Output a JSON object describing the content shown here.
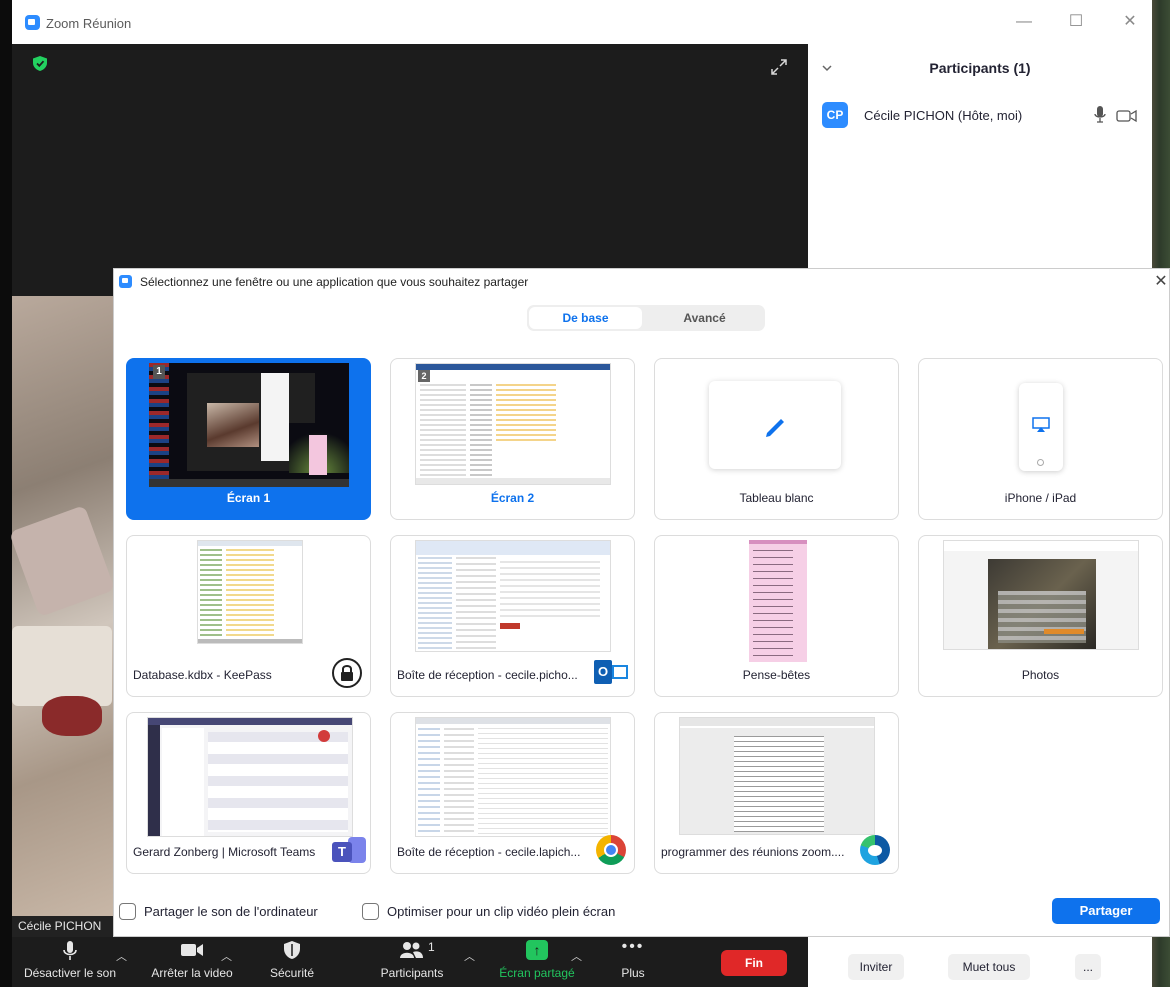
{
  "window": {
    "title": "Zoom Réunion",
    "minimize": "—",
    "maximize": "☐",
    "close": "✕"
  },
  "video": {
    "name_tag": "Cécile PICHON"
  },
  "participants": {
    "title": "Participants (1)",
    "items": [
      {
        "initials": "CP",
        "name": "Cécile PICHON (Hôte, moi)"
      }
    ]
  },
  "share_dialog": {
    "title": "Sélectionnez une fenêtre ou une application que vous souhaitez partager",
    "close": "✕",
    "tabs": [
      {
        "label": "De base",
        "active": true
      },
      {
        "label": "Avancé",
        "active": false
      }
    ],
    "tiles": [
      {
        "label": "Écran 1",
        "selected": true,
        "screen_number": "1"
      },
      {
        "label": "Écran 2",
        "selected": false,
        "screen_number": "2"
      },
      {
        "label": "Tableau blanc"
      },
      {
        "label": "iPhone / iPad"
      },
      {
        "label": "Database.kdbx - KeePass",
        "icon": "keepass-icon"
      },
      {
        "label": "Boîte de réception - cecile.picho...",
        "icon": "outlook-icon"
      },
      {
        "label": "Pense-bêtes"
      },
      {
        "label": "Photos"
      },
      {
        "label": "Gerard Zonberg | Microsoft Teams",
        "icon": "teams-icon"
      },
      {
        "label": "Boîte de réception - cecile.lapich...",
        "icon": "chrome-icon"
      },
      {
        "label": "programmer des réunions zoom....",
        "icon": "edge-icon"
      }
    ],
    "share_sound_label": "Partager le son de l'ordinateur",
    "optimize_video_label": "Optimiser pour un clip vidéo plein écran",
    "share_button": "Partager"
  },
  "toolbar": {
    "mute": "Désactiver le son",
    "stop_video": "Arrêter la video",
    "security": "Sécurité",
    "participants": "Participants",
    "participants_count": "1",
    "share_screen": "Écran partagé",
    "more": "Plus",
    "end": "Fin"
  },
  "panel_footer": {
    "invite": "Inviter",
    "mute_all": "Muet tous",
    "more": "..."
  },
  "colors": {
    "accent": "#0e72ed",
    "end": "#e02828",
    "share_green": "#22c55e",
    "security_green": "#23d160"
  }
}
